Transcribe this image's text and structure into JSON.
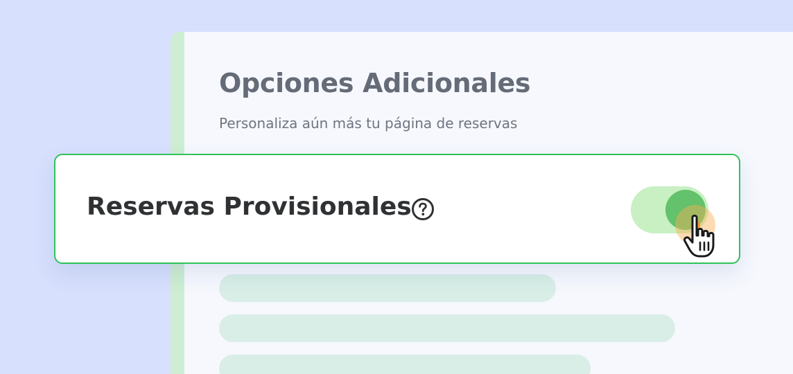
{
  "panel": {
    "title": "Opciones Adicionales",
    "subtitle": "Personaliza aún más tu página de reservas"
  },
  "option": {
    "label": "Reservas Provisionales",
    "toggle_state": "on"
  },
  "colors": {
    "background": "#d7e0fd",
    "panel": "#f6f8fe",
    "panel_accent": "#cdeed2",
    "card_border": "#2fc35a",
    "toggle_track": "#c8f0c3",
    "toggle_knob": "#63c26b",
    "click_highlight": "#f09235"
  },
  "icons": {
    "help": "help-circle-icon",
    "cursor": "hand-pointer-icon"
  }
}
